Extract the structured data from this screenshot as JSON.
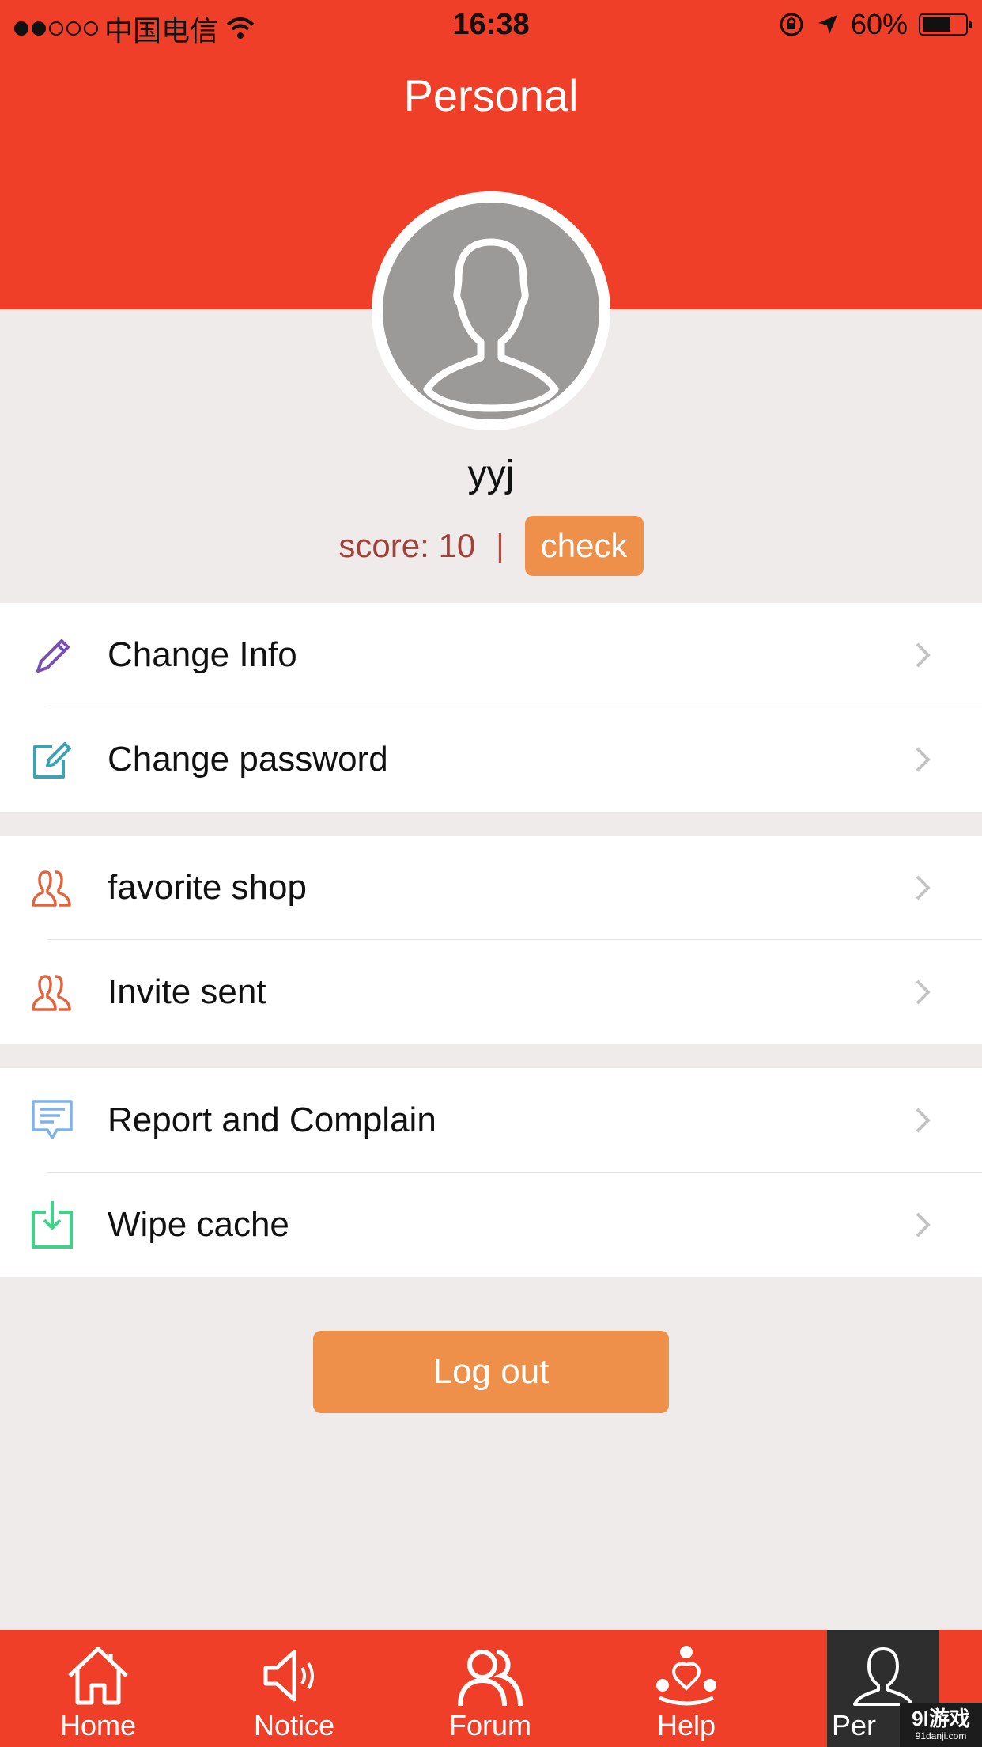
{
  "status_bar": {
    "carrier": "中国电信",
    "time": "16:38",
    "battery": "60%"
  },
  "header": {
    "title": "Personal"
  },
  "profile": {
    "username": "yyj",
    "score": "score: 10",
    "separator": "|",
    "check_label": "check"
  },
  "menu": {
    "change_info": "Change Info",
    "change_password": "Change password",
    "favorite_shop": "favorite shop",
    "invite_sent": "Invite sent",
    "report": "Report and Complain",
    "wipe_cache": "Wipe cache"
  },
  "logout_label": "Log out",
  "tabs": {
    "home": "Home",
    "notice": "Notice",
    "forum": "Forum",
    "help": "Help",
    "personal": "Per"
  },
  "watermark": {
    "text": "9l游戏",
    "url": "91danji.com"
  },
  "colors": {
    "header_red": "#f03f28",
    "orange": "#ef904a",
    "background": "#efebea",
    "tab_active": "#2e2e2e"
  }
}
